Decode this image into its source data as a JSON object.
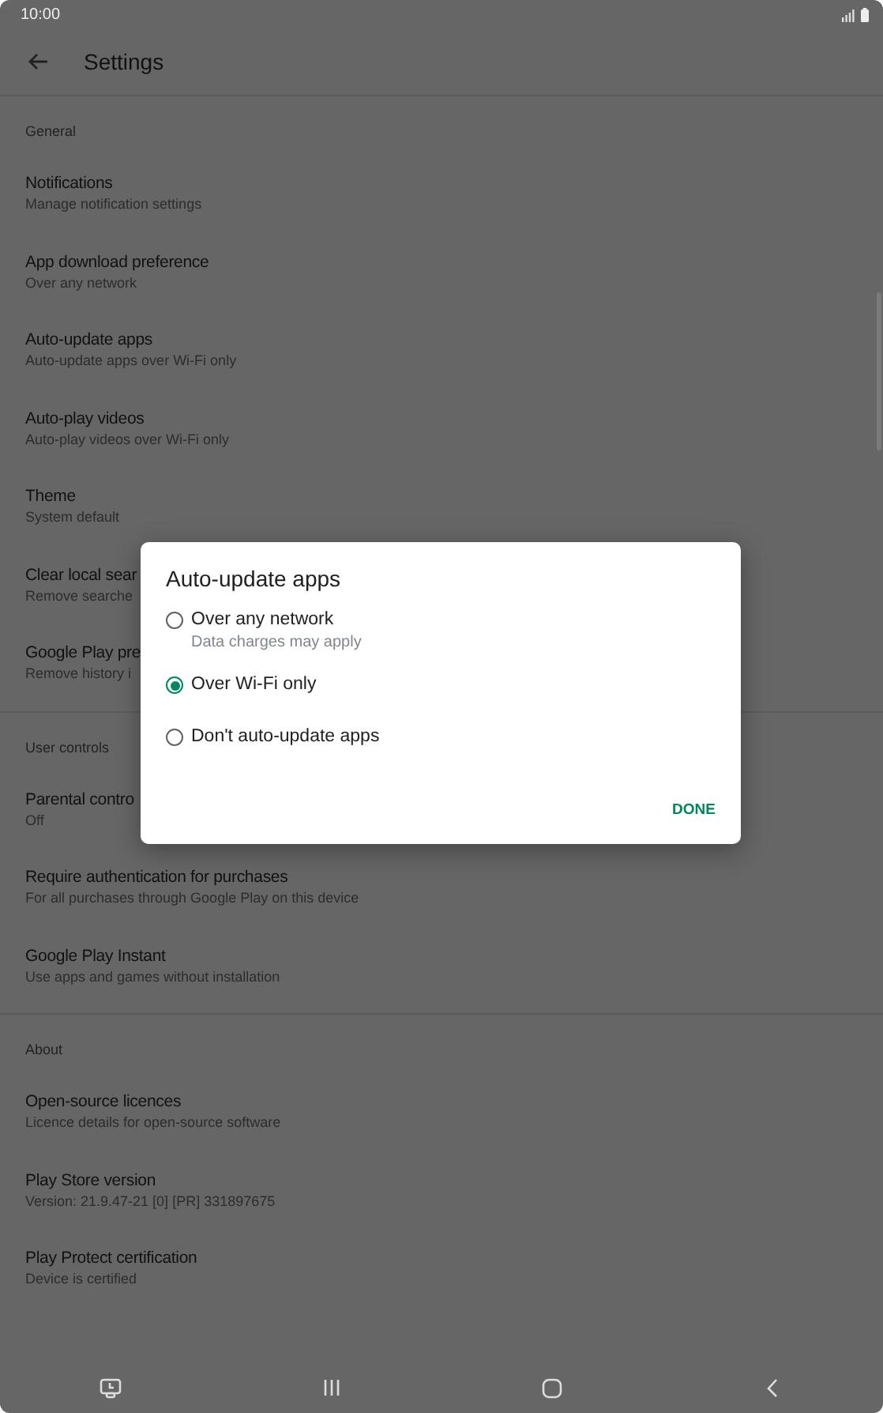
{
  "status_bar": {
    "time": "10:00"
  },
  "toolbar": {
    "title": "Settings"
  },
  "sections": [
    {
      "header": "General",
      "items": [
        {
          "title": "Notifications",
          "subtitle": "Manage notification settings"
        },
        {
          "title": "App download preference",
          "subtitle": "Over any network"
        },
        {
          "title": "Auto-update apps",
          "subtitle": "Auto-update apps over Wi-Fi only"
        },
        {
          "title": "Auto-play videos",
          "subtitle": "Auto-play videos over Wi-Fi only"
        },
        {
          "title": "Theme",
          "subtitle": "System default"
        },
        {
          "title": "Clear local sear",
          "subtitle": "Remove searche"
        },
        {
          "title": "Google Play pre",
          "subtitle": "Remove history i"
        }
      ]
    },
    {
      "header": "User controls",
      "items": [
        {
          "title": "Parental contro",
          "subtitle": "Off"
        },
        {
          "title": "Require authentication for purchases",
          "subtitle": "For all purchases through Google Play on this device"
        },
        {
          "title": "Google Play Instant",
          "subtitle": "Use apps and games without installation"
        }
      ]
    },
    {
      "header": "About",
      "items": [
        {
          "title": "Open-source licences",
          "subtitle": "Licence details for open-source software"
        },
        {
          "title": "Play Store version",
          "subtitle": "Version: 21.9.47-21 [0] [PR] 331897675"
        },
        {
          "title": "Play Protect certification",
          "subtitle": "Device is certified"
        }
      ]
    }
  ],
  "dialog": {
    "title": "Auto-update apps",
    "options": [
      {
        "label": "Over any network",
        "subtitle": "Data charges may apply",
        "selected": false
      },
      {
        "label": "Over Wi-Fi only",
        "selected": true
      },
      {
        "label": "Don't auto-update apps",
        "selected": false
      }
    ],
    "button": "DONE"
  }
}
